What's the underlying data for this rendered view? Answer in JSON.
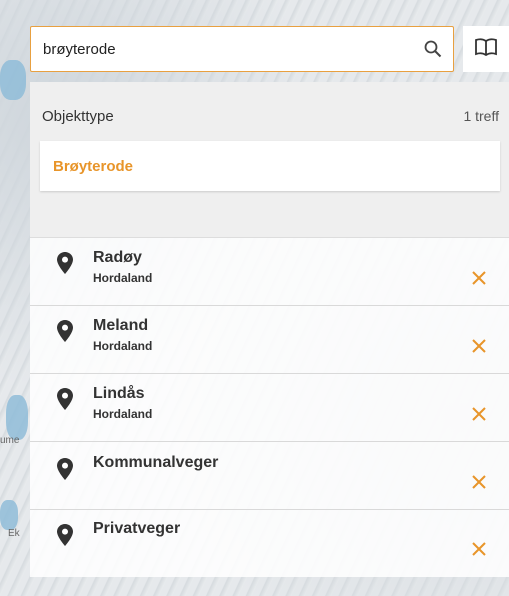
{
  "search": {
    "value": "brøyterode"
  },
  "results": {
    "type_header": "Objekttype",
    "hit_count": "1 treff",
    "items": [
      {
        "label": "Brøyterode"
      }
    ]
  },
  "filters": [
    {
      "title": "Radøy",
      "subtitle": "Hordaland"
    },
    {
      "title": "Meland",
      "subtitle": "Hordaland"
    },
    {
      "title": "Lindås",
      "subtitle": "Hordaland"
    },
    {
      "title": "Kommunalveger",
      "subtitle": ""
    },
    {
      "title": "Privatveger",
      "subtitle": ""
    }
  ],
  "colors": {
    "accent": "#e8952a",
    "pin": "#333333"
  }
}
